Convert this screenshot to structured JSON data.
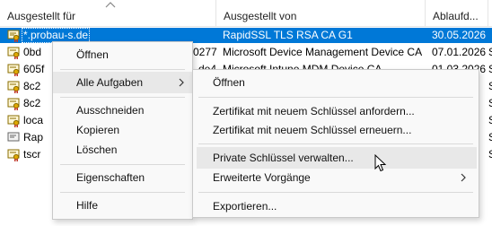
{
  "columns": {
    "issued_to": "Ausgestellt für",
    "issued_by": "Ausgestellt von",
    "expiry": "Ablaufd...",
    "extra": ""
  },
  "rows": [
    {
      "to": "*.probau-s.de",
      "by": "RapidSSL TLS RSA CA G1",
      "exp": "30.05.2026",
      "x": "",
      "selected": true
    },
    {
      "to": "0bd",
      "by_prefix": "0277",
      "by": "Microsoft Device Management Device CA",
      "exp": "07.01.2026",
      "x": "S"
    },
    {
      "to": "605f",
      "by_prefix": "de4",
      "by": "Microsoft Intune MDM Device CA",
      "exp": "01.03.2026",
      "x": "S"
    },
    {
      "to": "8c2",
      "by_prefix": "",
      "by": "",
      "exp": "",
      "x": "S"
    },
    {
      "to": "8c2",
      "by_prefix": "",
      "by": "",
      "exp": "",
      "x": "S"
    },
    {
      "to": "loca",
      "by_prefix": "",
      "by": "",
      "exp": "",
      "x": "S"
    },
    {
      "to": "Rap",
      "by_prefix": "",
      "by": "",
      "exp": "",
      "x": "S"
    },
    {
      "to": "tscr",
      "by_prefix": "",
      "by": "",
      "exp": "",
      "x": "S"
    }
  ],
  "context_menu": {
    "open": "Öffnen",
    "all_tasks": "Alle Aufgaben",
    "cut": "Ausschneiden",
    "copy": "Kopieren",
    "delete": "Löschen",
    "properties": "Eigenschaften",
    "help": "Hilfe"
  },
  "submenu": {
    "open": "Öffnen",
    "request_new_key": "Zertifikat mit neuem Schlüssel anfordern...",
    "renew_new_key": "Zertifikat mit neuem Schlüssel erneuern...",
    "manage_private_keys": "Private Schlüssel verwalten...",
    "advanced": "Erweiterte Vorgänge",
    "export": "Exportieren..."
  },
  "colors": {
    "selection": "#0078d7",
    "menu_bg": "#f9f9f9",
    "hover": "#e8e8e8"
  },
  "icons": [
    "sort-up-arrow-icon",
    "certificate-icon",
    "chevron-right-icon",
    "mouse-cursor-icon"
  ]
}
